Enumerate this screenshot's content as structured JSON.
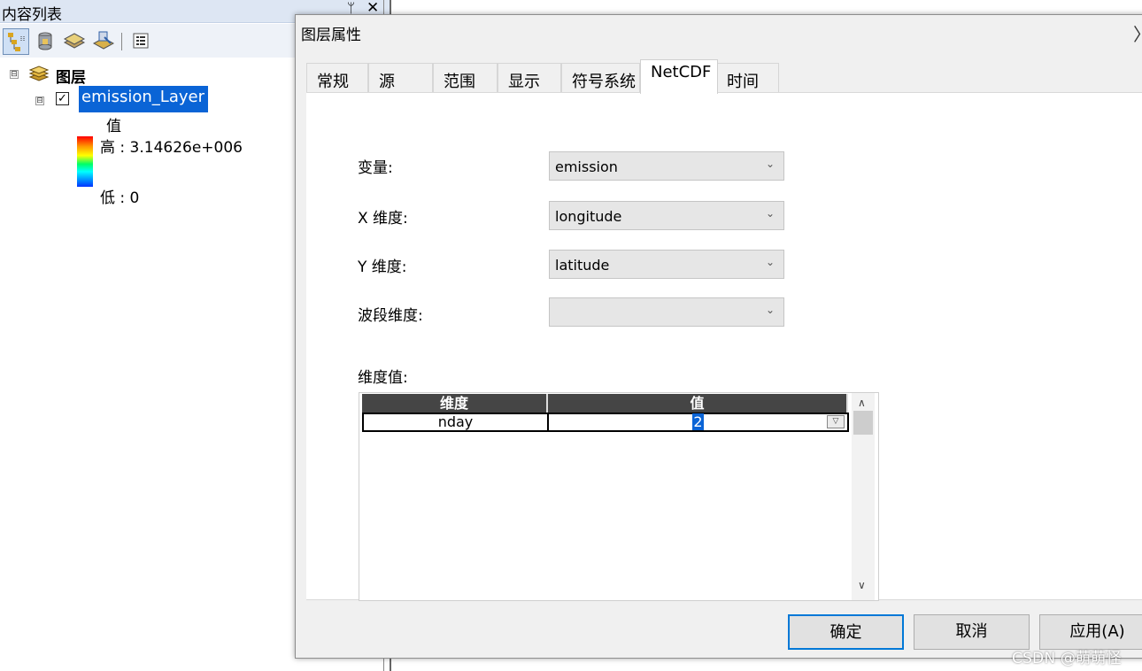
{
  "toc": {
    "title": "内容列表",
    "pin": "ᛘ",
    "close": "✕",
    "toolbar": {
      "icons": [
        "list-by-drawing-order-icon",
        "list-by-source-icon",
        "list-by-visibility-icon",
        "list-by-selection-icon",
        "options-icon"
      ],
      "active": "list-by-drawing-order-icon"
    },
    "layers_root": {
      "label": "图层",
      "expander": "⊟"
    },
    "layer": {
      "name": "emission_Layer",
      "checked": true,
      "check_mark": "✓",
      "expander": "⊟",
      "legend": {
        "title": "值",
        "high": "高 : 3.14626e+006",
        "low": "低 : 0",
        "ramp_colors": [
          "#ff0000",
          "#ff9900",
          "#ffff00",
          "#00ff66",
          "#00ffff",
          "#0033ff"
        ]
      }
    }
  },
  "dialog": {
    "title": "图层属性",
    "close": "〉",
    "tabs": [
      {
        "label": "常规",
        "selected": false
      },
      {
        "label": "源",
        "selected": false
      },
      {
        "label": "范围",
        "selected": false
      },
      {
        "label": "显示",
        "selected": false
      },
      {
        "label": "符号系统",
        "selected": false
      },
      {
        "label": "NetCDF",
        "selected": true
      },
      {
        "label": "时间",
        "selected": false
      }
    ],
    "fields": [
      {
        "label": "变量:",
        "value": "emission"
      },
      {
        "label": "X 维度:",
        "value": "longitude"
      },
      {
        "label": "Y 维度:",
        "value": "latitude"
      },
      {
        "label": "波段维度:",
        "value": ""
      }
    ],
    "dropdown_arrow": "⌄",
    "dimension_values": {
      "label": "维度值:",
      "columns": [
        "维度",
        "值"
      ],
      "rows": [
        {
          "dimension": "nday",
          "value": "2"
        }
      ],
      "cell_dropdown": "▽",
      "scroll_up": "∧",
      "scroll_down": "∨"
    },
    "buttons": {
      "ok": "确定",
      "cancel": "取消",
      "apply": "应用(A)"
    }
  },
  "watermark": "CSDN @萌萌怪",
  "colors": {
    "selection": "#0a64d6",
    "grid_header": "#454545",
    "default_button_border": "#0078d7"
  }
}
